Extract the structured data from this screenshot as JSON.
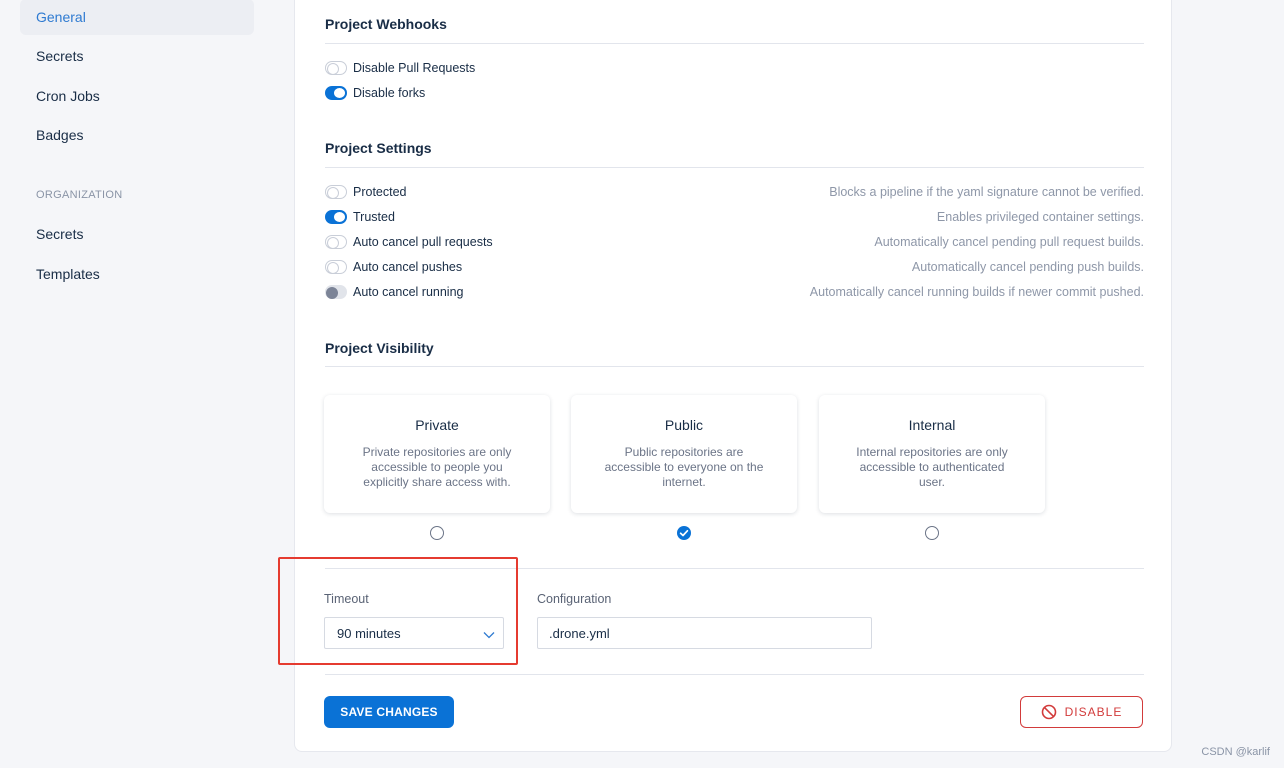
{
  "sidebar": {
    "items": [
      {
        "label": "General"
      },
      {
        "label": "Secrets"
      },
      {
        "label": "Cron Jobs"
      },
      {
        "label": "Badges"
      }
    ],
    "org_section": "ORGANIZATION",
    "org_items": [
      {
        "label": "Secrets"
      },
      {
        "label": "Templates"
      }
    ]
  },
  "webhooks": {
    "title": "Project Webhooks",
    "toggles": [
      {
        "label": "Disable Pull Requests",
        "state": "off"
      },
      {
        "label": "Disable forks",
        "state": "on"
      }
    ]
  },
  "settings": {
    "title": "Project Settings",
    "toggles": [
      {
        "label": "Protected",
        "desc": "Blocks a pipeline if the yaml signature cannot be verified.",
        "state": "off"
      },
      {
        "label": "Trusted",
        "desc": "Enables privileged container settings.",
        "state": "on"
      },
      {
        "label": "Auto cancel pull requests",
        "desc": "Automatically cancel pending pull request builds.",
        "state": "off"
      },
      {
        "label": "Auto cancel pushes",
        "desc": "Automatically cancel pending push builds.",
        "state": "off"
      },
      {
        "label": "Auto cancel running",
        "desc": "Automatically cancel running builds if newer commit pushed.",
        "state": "disabled"
      }
    ]
  },
  "visibility": {
    "title": "Project Visibility",
    "options": [
      {
        "title": "Private",
        "desc": "Private repositories are only accessible to people you explicitly share access with.",
        "selected": false
      },
      {
        "title": "Public",
        "desc": "Public repositories are accessible to everyone on the internet.",
        "selected": true
      },
      {
        "title": "Internal",
        "desc": "Internal repositories are only accessible to authenticated user.",
        "selected": false
      }
    ]
  },
  "timeout": {
    "label": "Timeout",
    "value": "90 minutes"
  },
  "configuration": {
    "label": "Configuration",
    "value": ".drone.yml"
  },
  "buttons": {
    "save": "SAVE CHANGES",
    "disable": "DISABLE"
  },
  "watermark": "CSDN @karlif",
  "colors": {
    "accent": "#0a72d6",
    "danger": "#d23b3b",
    "highlight": "#e53b30"
  }
}
